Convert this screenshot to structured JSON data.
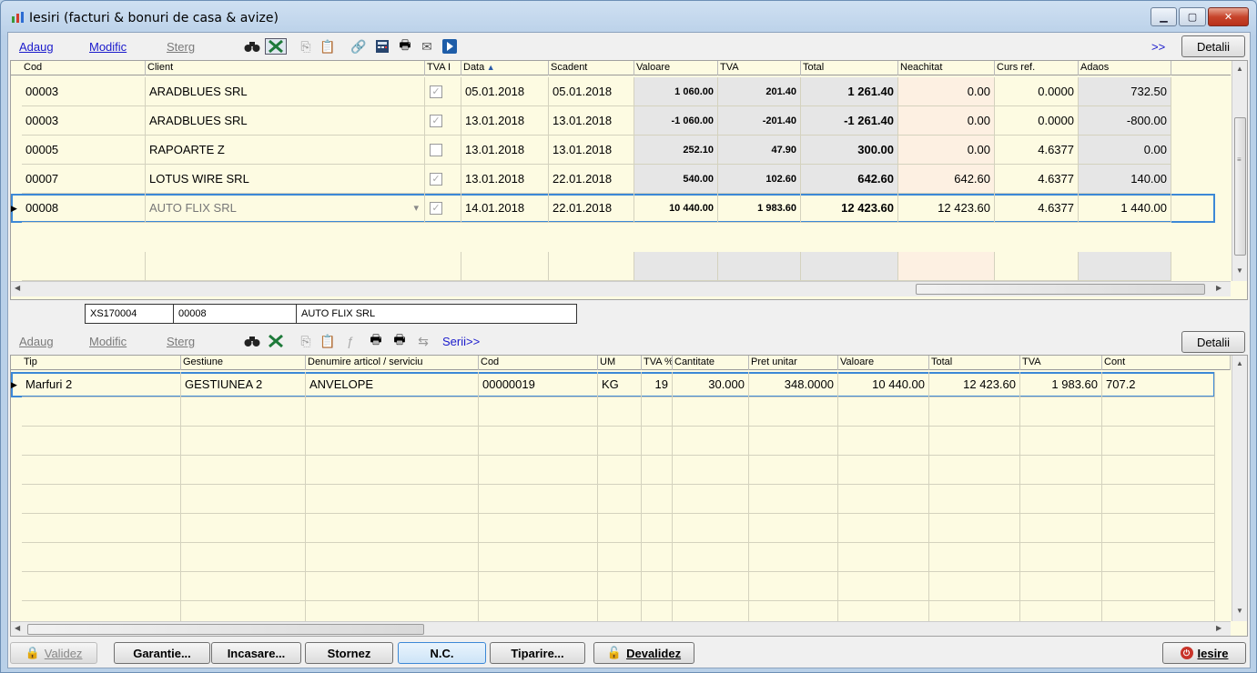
{
  "window": {
    "title": "Iesiri (facturi & bonuri de casa & avize)"
  },
  "top_toolbar": {
    "add": "Adaug",
    "modify": "Modific",
    "delete": "Sterg",
    "more": ">>",
    "details": "Detalii"
  },
  "invoices": {
    "columns": [
      "Cod",
      "Client",
      "TVA I",
      "Data",
      "Scadent",
      "Valoare",
      "TVA",
      "Total",
      "Neachitat",
      "Curs ref.",
      "Adaos"
    ],
    "rows": [
      {
        "cod": "00003",
        "client": "ARADBLUES SRL",
        "tva_i": true,
        "data": "05.01.2018",
        "scadent": "05.01.2018",
        "valoare": "1 060.00",
        "tva": "201.40",
        "total": "1 261.40",
        "neachitat": "0.00",
        "curs": "0.0000",
        "adaos": "732.50"
      },
      {
        "cod": "00003",
        "client": "ARADBLUES SRL",
        "tva_i": true,
        "data": "13.01.2018",
        "scadent": "13.01.2018",
        "valoare": "-1 060.00",
        "tva": "-201.40",
        "total": "-1 261.40",
        "neachitat": "0.00",
        "curs": "0.0000",
        "adaos": "-800.00"
      },
      {
        "cod": "00005",
        "client": "RAPOARTE Z",
        "tva_i": false,
        "data": "13.01.2018",
        "scadent": "13.01.2018",
        "valoare": "252.10",
        "tva": "47.90",
        "total": "300.00",
        "neachitat": "0.00",
        "curs": "4.6377",
        "adaos": "0.00"
      },
      {
        "cod": "00007",
        "client": "LOTUS WIRE SRL",
        "tva_i": true,
        "data": "13.01.2018",
        "scadent": "22.01.2018",
        "valoare": "540.00",
        "tva": "102.60",
        "total": "642.60",
        "neachitat": "642.60",
        "curs": "4.6377",
        "adaos": "140.00"
      },
      {
        "cod": "00008",
        "client": "AUTO FLIX SRL",
        "tva_i": true,
        "data": "14.01.2018",
        "scadent": "22.01.2018",
        "valoare": "10 440.00",
        "tva": "1 983.60",
        "total": "12 423.60",
        "neachitat": "12 423.60",
        "curs": "4.6377",
        "adaos": "1 440.00"
      }
    ],
    "selected_index": 4
  },
  "selected_invoice_info": {
    "number": "XS170004",
    "code": "00008",
    "client": "AUTO FLIX SRL"
  },
  "bottom_toolbar": {
    "add": "Adaug",
    "modify": "Modific",
    "delete": "Sterg",
    "series": "Serii>>",
    "details": "Detalii"
  },
  "lines": {
    "columns": [
      "Tip",
      "Gestiune",
      "Denumire articol / serviciu",
      "Cod",
      "UM",
      "TVA %",
      "Cantitate",
      "Pret unitar",
      "Valoare",
      "Total",
      "TVA",
      "Cont"
    ],
    "rows": [
      {
        "tip": "Marfuri 2",
        "gestiune": "GESTIUNEA 2",
        "denumire": "ANVELOPE",
        "cod": "00000019",
        "um": "KG",
        "tva_pct": "19",
        "cantitate": "30.000",
        "pret": "348.0000",
        "valoare": "10 440.00",
        "total": "12 423.60",
        "tva": "1 983.60",
        "cont": "707.2"
      }
    ]
  },
  "footer": {
    "validate": "Validez",
    "warranty": "Garantie...",
    "collect": "Incasare...",
    "reverse": "Stornez",
    "credit_note": "N.C.",
    "print": "Tiparire...",
    "invalidate": "Devalidez",
    "exit": "Iesire"
  },
  "colors": {
    "grid_bg": "#fdfbe2",
    "selection": "#3c88d6",
    "link": "#1a1acc"
  }
}
